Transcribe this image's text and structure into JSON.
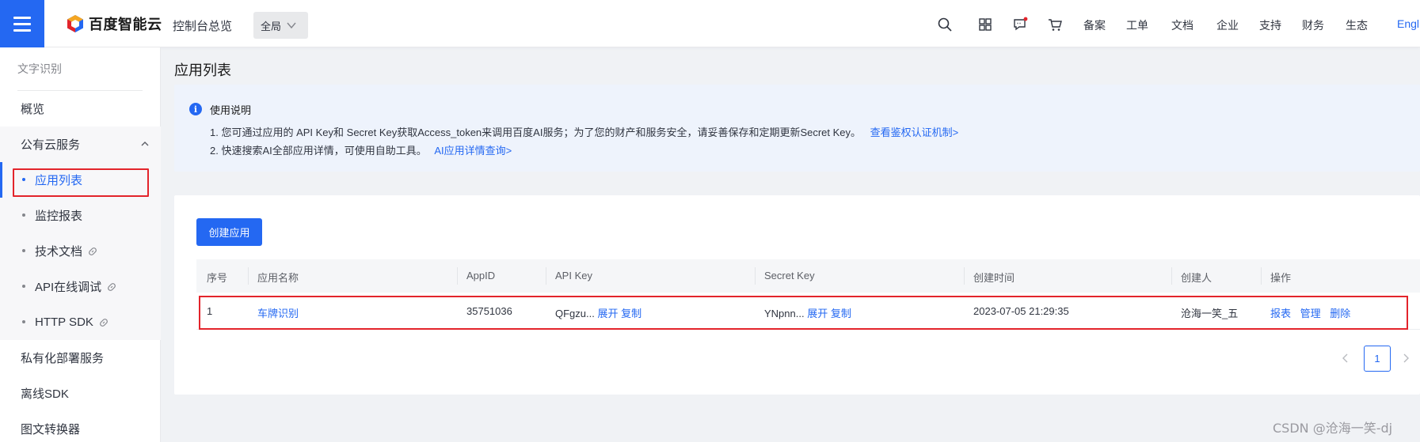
{
  "header": {
    "logo_text": "百度智能云",
    "console_link": "控制台总览",
    "region": "全局",
    "nav": [
      "备案",
      "工单",
      "文档",
      "企业",
      "支持",
      "财务",
      "生态"
    ],
    "lang": "Engli",
    "icons": [
      "search-icon",
      "grid-icon",
      "message-icon",
      "cart-icon"
    ],
    "accent": "#2468f2"
  },
  "sidebar": {
    "title": "文字识别",
    "items": [
      {
        "label": "概览"
      },
      {
        "label": "公有云服务"
      },
      {
        "label": "应用列表"
      },
      {
        "label": "监控报表"
      },
      {
        "label": "技术文档"
      },
      {
        "label": "API在线调试"
      },
      {
        "label": "HTTP SDK"
      },
      {
        "label": "私有化部署服务"
      },
      {
        "label": "离线SDK"
      },
      {
        "label": "图文转换器"
      }
    ]
  },
  "main": {
    "title": "应用列表",
    "info": {
      "title": "使用说明",
      "line1": "1. 您可通过应用的 API Key和 Secret Key获取Access_token来调用百度AI服务；为了您的财产和服务安全，请妥善保存和定期更新Secret Key。",
      "line1_link": "查看鉴权认证机制>",
      "line2": "2. 快速搜索AI全部应用详情，可使用自助工具。",
      "line2_link": "AI应用详情查询>"
    },
    "create_button": "创建应用",
    "table": {
      "headers": [
        "序号",
        "应用名称",
        "AppID",
        "API Key",
        "Secret Key",
        "创建时间",
        "创建人",
        "操作"
      ],
      "rows": [
        {
          "index": "1",
          "name": "车牌识别",
          "appid": "35751036",
          "api_key": "QFgzu...",
          "secret_key": "YNpnn...",
          "expand": "展开",
          "copy": "复制",
          "created": "2023-07-05 21:29:35",
          "creator": "沧海一笑_五",
          "actions": [
            "报表",
            "管理",
            "删除"
          ]
        }
      ]
    },
    "pager": {
      "current": "1"
    }
  },
  "watermark": "CSDN @沧海一笑-dj"
}
